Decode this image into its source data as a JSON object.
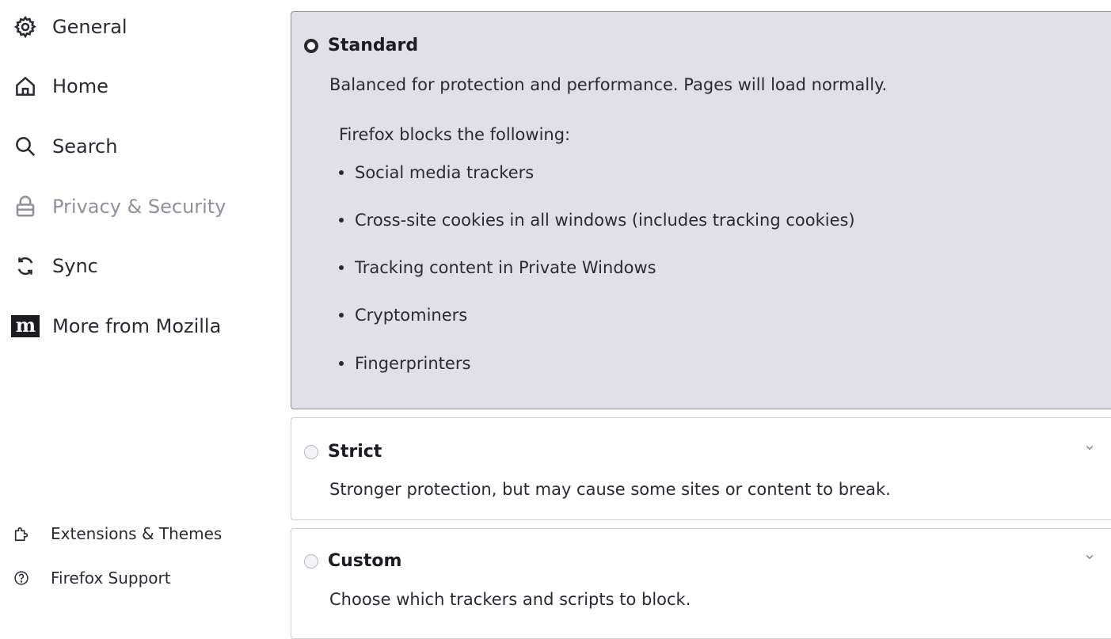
{
  "sidebar": {
    "items": [
      {
        "label": "General",
        "icon": "gear-icon"
      },
      {
        "label": "Home",
        "icon": "home-icon"
      },
      {
        "label": "Search",
        "icon": "search-icon"
      },
      {
        "label": "Privacy & Security",
        "icon": "lock-icon",
        "selected": true
      },
      {
        "label": "Sync",
        "icon": "sync-icon"
      },
      {
        "label": "More from Mozilla",
        "icon": "mozilla-m-icon",
        "badge": "m"
      }
    ],
    "footer": [
      {
        "label": "Extensions & Themes",
        "icon": "puzzle-icon"
      },
      {
        "label": "Firefox Support",
        "icon": "help-icon"
      }
    ]
  },
  "options": {
    "standard": {
      "title": "Standard",
      "description": "Balanced for protection and performance. Pages will load normally.",
      "blocks_label": "Firefox blocks the following:",
      "blocks": [
        "Social media trackers",
        "Cross-site cookies in all windows (includes tracking cookies)",
        "Tracking content in Private Windows",
        "Cryptominers",
        "Fingerprinters"
      ],
      "checked": true
    },
    "strict": {
      "title": "Strict",
      "description": "Stronger protection, but may cause some sites or content to break.",
      "checked": false
    },
    "custom": {
      "title": "Custom",
      "description": "Choose which trackers and scripts to block.",
      "checked": false
    }
  },
  "colors": {
    "selected_card_bg": "#e0e0e6",
    "text": "#2b2a33",
    "muted": "#8f8f9d"
  }
}
